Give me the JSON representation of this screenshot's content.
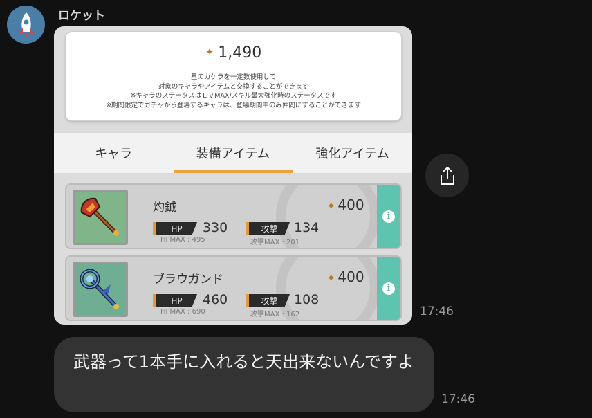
{
  "sender": {
    "name": "ロケット"
  },
  "card": {
    "points": "1,490",
    "description": [
      "星のカケラを一定数使用して",
      "対象のキャラやアイテムと交換することができます",
      "※キャラのステータスはＬｖMAX/スキル最大強化時のステータスです",
      "※期間限定でガチャから登場するキャラは、登場期間中のみ仲間にすることができます"
    ],
    "tabs": [
      {
        "label": "キャラ",
        "active": false
      },
      {
        "label": "装備アイテム",
        "active": true
      },
      {
        "label": "強化アイテム",
        "active": false
      }
    ],
    "items": [
      {
        "name": "灼鉞",
        "cost": "400",
        "hp_label": "HP",
        "hp": "330",
        "hp_max": "HPMAX : 495",
        "atk_label": "攻撃",
        "atk": "134",
        "atk_max": "攻撃MAX : 201",
        "icon": "fire-axe-icon"
      },
      {
        "name": "ブラウガンド",
        "cost": "400",
        "hp_label": "HP",
        "hp": "460",
        "hp_max": "HPMAX : 690",
        "atk_label": "攻撃",
        "atk": "108",
        "atk_max": "攻撃MAX : 162",
        "icon": "blue-staff-icon"
      }
    ]
  },
  "card_time": "17:46",
  "message": {
    "text": "武器って1本手に入れると天出来ないんですよ",
    "time": "17:46"
  },
  "colors": {
    "accent": "#e8a33d",
    "info": "#5ec4b0",
    "bubble": "#333333"
  }
}
